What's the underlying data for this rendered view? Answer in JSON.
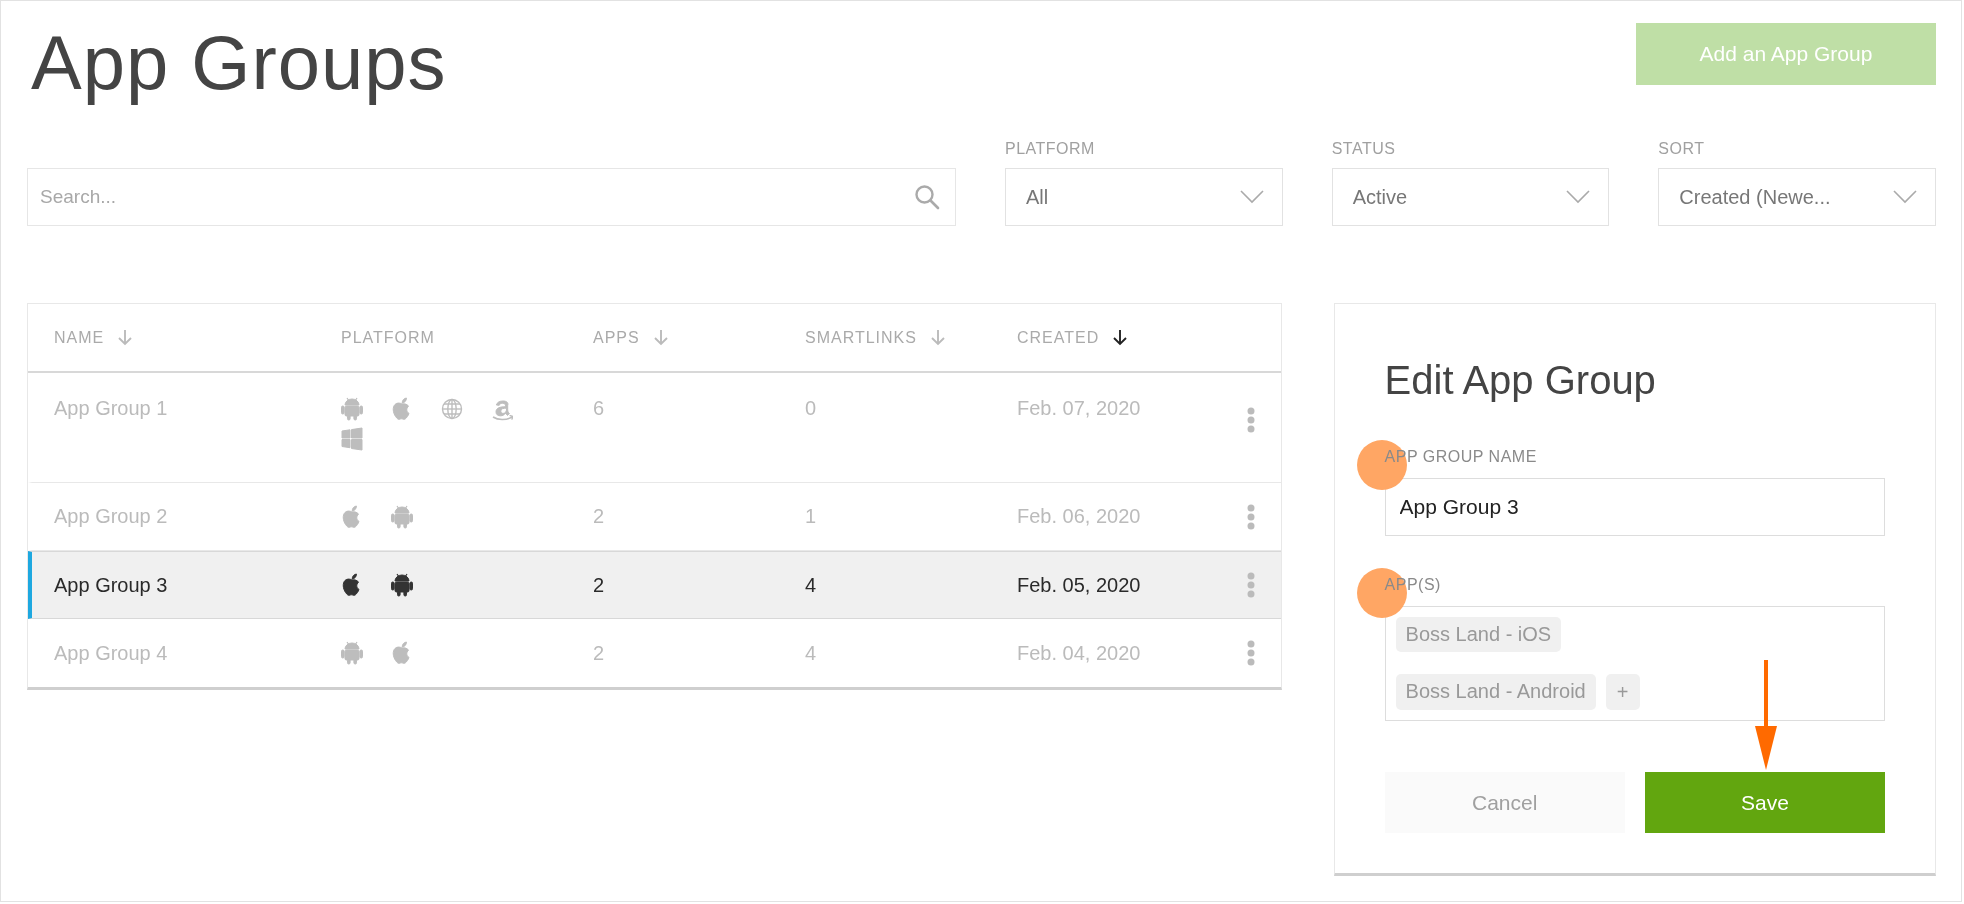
{
  "page": {
    "title": "App Groups",
    "add_button": "Add an App Group"
  },
  "filters": {
    "search": {
      "placeholder": "Search..."
    },
    "dropdowns": [
      {
        "label": "PLATFORM",
        "value": "All"
      },
      {
        "label": "STATUS",
        "value": "Active"
      },
      {
        "label": "SORT",
        "value": "Created (Newe..."
      }
    ]
  },
  "table": {
    "columns": [
      {
        "label": "NAME",
        "sortable": true,
        "sort_active": false
      },
      {
        "label": "PLATFORM",
        "sortable": false,
        "sort_active": false
      },
      {
        "label": "APPS",
        "sortable": true,
        "sort_active": false
      },
      {
        "label": "SMARTLINKS",
        "sortable": true,
        "sort_active": false
      },
      {
        "label": "CREATED",
        "sortable": true,
        "sort_active": true
      }
    ],
    "rows": [
      {
        "name": "App Group 1",
        "platforms": [
          {
            "kind": "android"
          },
          {
            "kind": "apple"
          },
          {
            "kind": "web"
          },
          {
            "kind": "amazon"
          },
          {
            "kind": "windows"
          }
        ],
        "apps": "6",
        "smartlinks": "0",
        "created": "Feb. 07, 2020",
        "selected": false
      },
      {
        "name": "App Group 2",
        "platforms": [
          {
            "kind": "apple"
          },
          {
            "kind": "android"
          }
        ],
        "apps": "2",
        "smartlinks": "1",
        "created": "Feb. 06, 2020",
        "selected": false
      },
      {
        "name": "App Group 3",
        "platforms": [
          {
            "kind": "apple"
          },
          {
            "kind": "android"
          }
        ],
        "apps": "2",
        "smartlinks": "4",
        "created": "Feb. 05, 2020",
        "selected": true
      },
      {
        "name": "App Group 4",
        "platforms": [
          {
            "kind": "android"
          },
          {
            "kind": "apple"
          }
        ],
        "apps": "2",
        "smartlinks": "4",
        "created": "Feb. 04, 2020",
        "selected": false
      }
    ]
  },
  "edit_panel": {
    "title": "Edit App Group",
    "name_field": {
      "label": "APP GROUP NAME",
      "value": "App Group 3"
    },
    "apps_field": {
      "label": "APP(S)",
      "tags": [
        "Boss Land - iOS",
        "Boss Land - Android"
      ],
      "add": "+"
    },
    "cancel": "Cancel",
    "save": "Save"
  }
}
